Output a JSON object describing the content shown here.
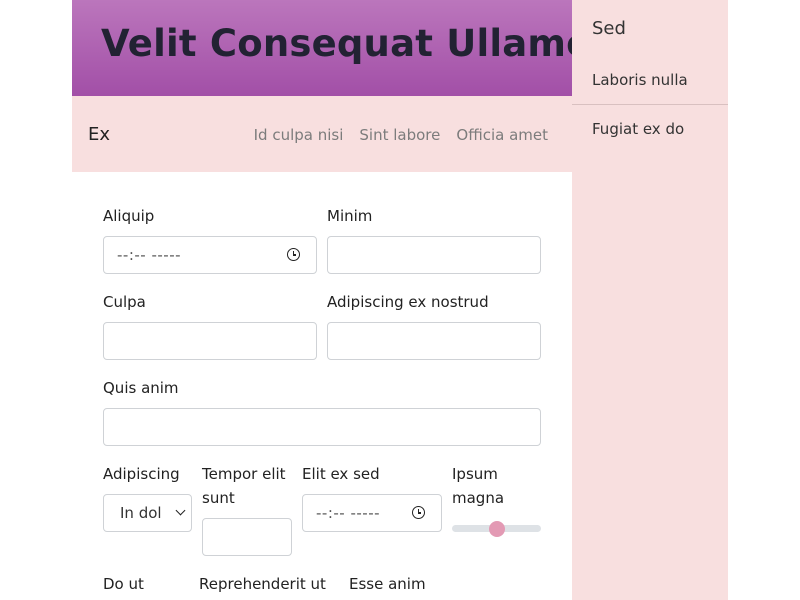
{
  "header": {
    "title": "Velit Consequat Ullamco"
  },
  "navbar": {
    "brand": "Ex",
    "links": [
      "Id culpa nisi",
      "Sint labore",
      "Officia amet"
    ]
  },
  "form": {
    "aliquip": {
      "label": "Aliquip",
      "value": "--:-- -----"
    },
    "minim": {
      "label": "Minim",
      "value": ""
    },
    "culpa": {
      "label": "Culpa",
      "value": ""
    },
    "adipiscing_ex_nostrud": {
      "label": "Adipiscing ex nostrud",
      "value": ""
    },
    "quis_anim": {
      "label": "Quis anim",
      "value": ""
    },
    "adipiscing": {
      "label": "Adipiscing",
      "selected": "In dol"
    },
    "tempor": {
      "label": "Tempor elit sunt",
      "value": ""
    },
    "elit_ex_sed": {
      "label": "Elit ex sed",
      "value": "--:-- -----"
    },
    "ipsum_magna": {
      "label": "Ipsum magna",
      "level": 0.5
    },
    "do_ut": {
      "label": "Do ut"
    },
    "reprehenderit": {
      "label": "Reprehenderit ut"
    },
    "esse_anim": {
      "label": "Esse anim"
    }
  },
  "sidebar": {
    "title": "Sed",
    "items": [
      "Laboris nulla",
      "Fugiat ex do"
    ]
  },
  "colors": {
    "header_gradient_top": "#bb76bc",
    "header_gradient_bottom": "#a24fa7",
    "panel_pink": "#f8dfdf",
    "slider_thumb": "#e39ab4"
  }
}
